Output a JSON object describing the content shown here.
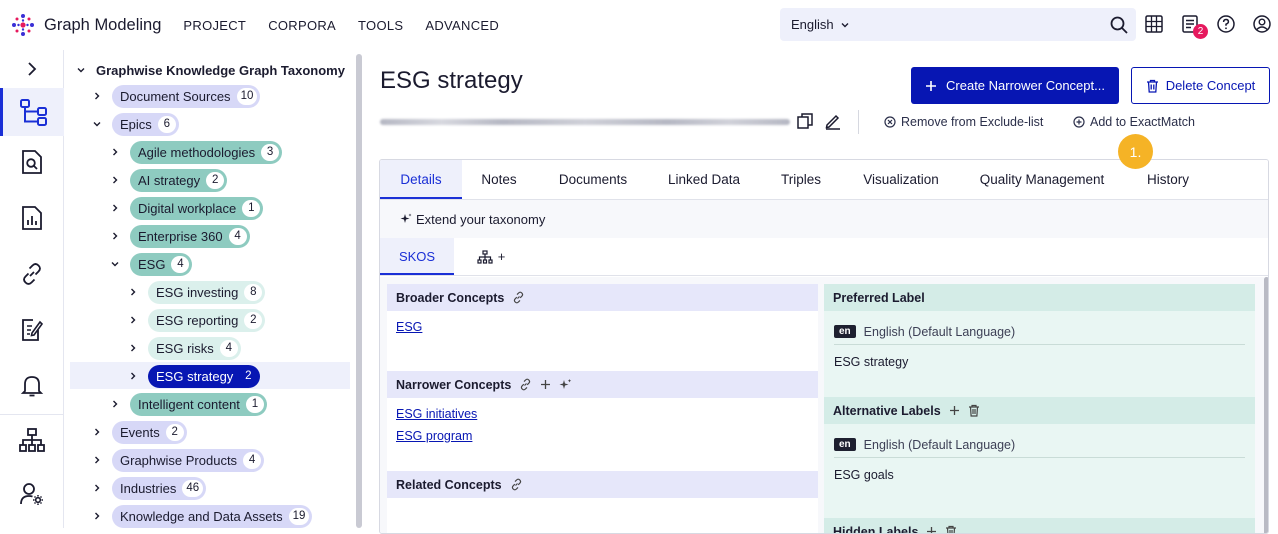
{
  "app": {
    "title": "Graph Modeling"
  },
  "topnav": [
    "PROJECT",
    "CORPORA",
    "TOOLS",
    "ADVANCED"
  ],
  "search": {
    "language": "English"
  },
  "notifications": {
    "count": "2"
  },
  "tree": {
    "root": "Graphwise Knowledge Graph Taxonomy",
    "nodes": [
      {
        "label": "Document Sources",
        "count": "10"
      },
      {
        "label": "Epics",
        "count": "6"
      },
      {
        "label": "Agile methodologies",
        "count": "3"
      },
      {
        "label": "AI strategy",
        "count": "2"
      },
      {
        "label": "Digital workplace",
        "count": "1"
      },
      {
        "label": "Enterprise 360",
        "count": "4"
      },
      {
        "label": "ESG",
        "count": "4"
      },
      {
        "label": "ESG investing",
        "count": "8"
      },
      {
        "label": "ESG reporting",
        "count": "2"
      },
      {
        "label": "ESG risks",
        "count": "4"
      },
      {
        "label": "ESG strategy",
        "count": "2"
      },
      {
        "label": "Intelligent content",
        "count": "1"
      },
      {
        "label": "Events",
        "count": "2"
      },
      {
        "label": "Graphwise Products",
        "count": "4"
      },
      {
        "label": "Industries",
        "count": "46"
      },
      {
        "label": "Knowledge and Data Assets",
        "count": "19"
      }
    ]
  },
  "concept": {
    "title": "ESG strategy",
    "create_label": "Create Narrower Concept...",
    "delete_label": "Delete Concept",
    "remove_exclude": "Remove from Exclude-list",
    "add_exactmatch": "Add to ExactMatch",
    "step_marker": "1."
  },
  "tabs": [
    "Details",
    "Notes",
    "Documents",
    "Linked Data",
    "Triples",
    "Visualization",
    "Quality Management",
    "History"
  ],
  "extend_label": "Extend your taxonomy",
  "subtabs": {
    "skos": "SKOS",
    "plus": "+"
  },
  "skos": {
    "broader": {
      "title": "Broader Concepts",
      "items": [
        "ESG"
      ]
    },
    "narrower": {
      "title": "Narrower Concepts",
      "items": [
        "ESG initiatives",
        "ESG program"
      ]
    },
    "related": {
      "title": "Related Concepts"
    },
    "preferred": {
      "title": "Preferred Label",
      "lang_code": "en",
      "lang": "English  (Default Language)",
      "value": "ESG strategy"
    },
    "alternative": {
      "title": "Alternative Labels",
      "lang_code": "en",
      "lang": "English  (Default Language)",
      "value": "ESG goals"
    },
    "hidden": {
      "title": "Hidden Labels"
    }
  },
  "colors": {
    "primary": "#0716b3",
    "accent": "#1a2fd6",
    "marker": "#f5b326",
    "badge": "#e6195e"
  }
}
